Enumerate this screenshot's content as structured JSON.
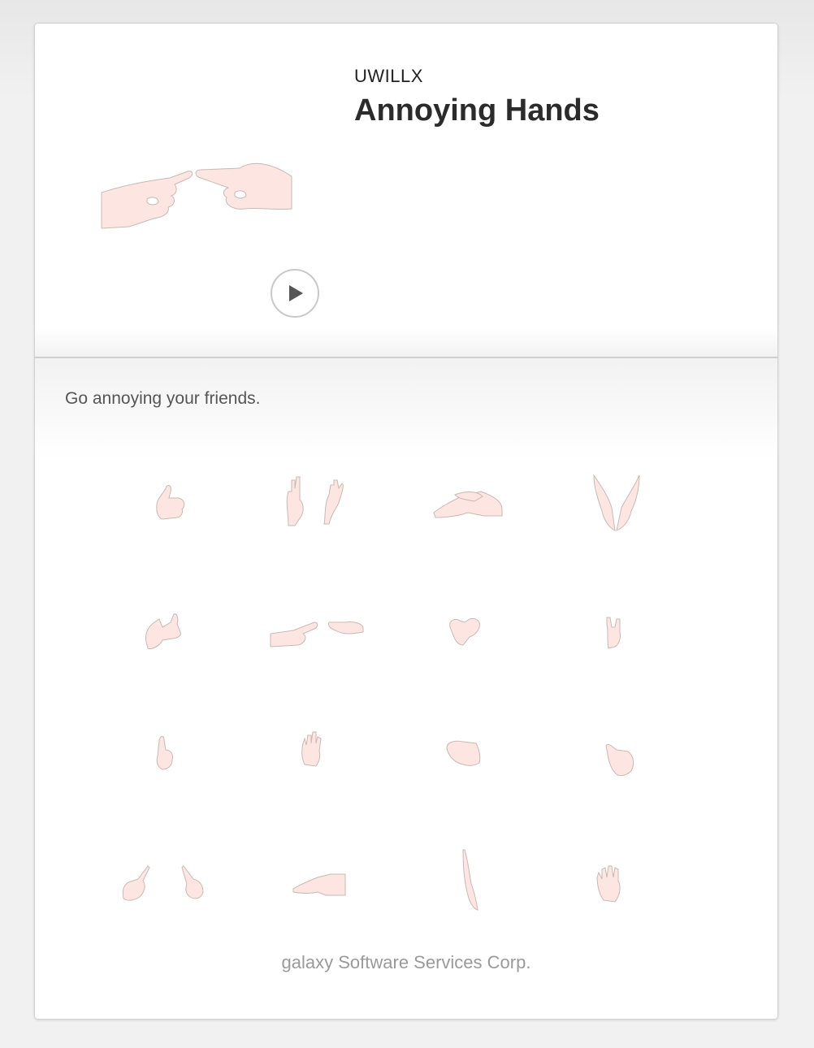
{
  "app": {
    "developer": "UWILLX",
    "title": "Annoying Hands"
  },
  "description": {
    "tagline": "Go annoying your friends."
  },
  "preview": {
    "play_icon": "play-icon",
    "hand_icons": [
      "thumbs-up-icon",
      "raised-hands-icon",
      "rubbing-hands-icon",
      "praying-hands-icon",
      "thumb-point-icon",
      "pointing-fingers-icon",
      "clasped-fists-icon",
      "rock-sign-icon",
      "index-up-icon",
      "open-palm-icon",
      "fist-icon",
      "thumb-tilt-icon",
      "crossed-pointers-icon",
      "flat-hand-icon",
      "blade-hand-icon",
      "spread-fingers-icon"
    ]
  },
  "footer": {
    "publisher": "galaxy Software Services Corp."
  },
  "colors": {
    "hand_fill": "#fde6e2",
    "hand_stroke": "#c9b8b4",
    "title_text": "#2b2b2b",
    "footer_text": "#9a9a9a"
  }
}
